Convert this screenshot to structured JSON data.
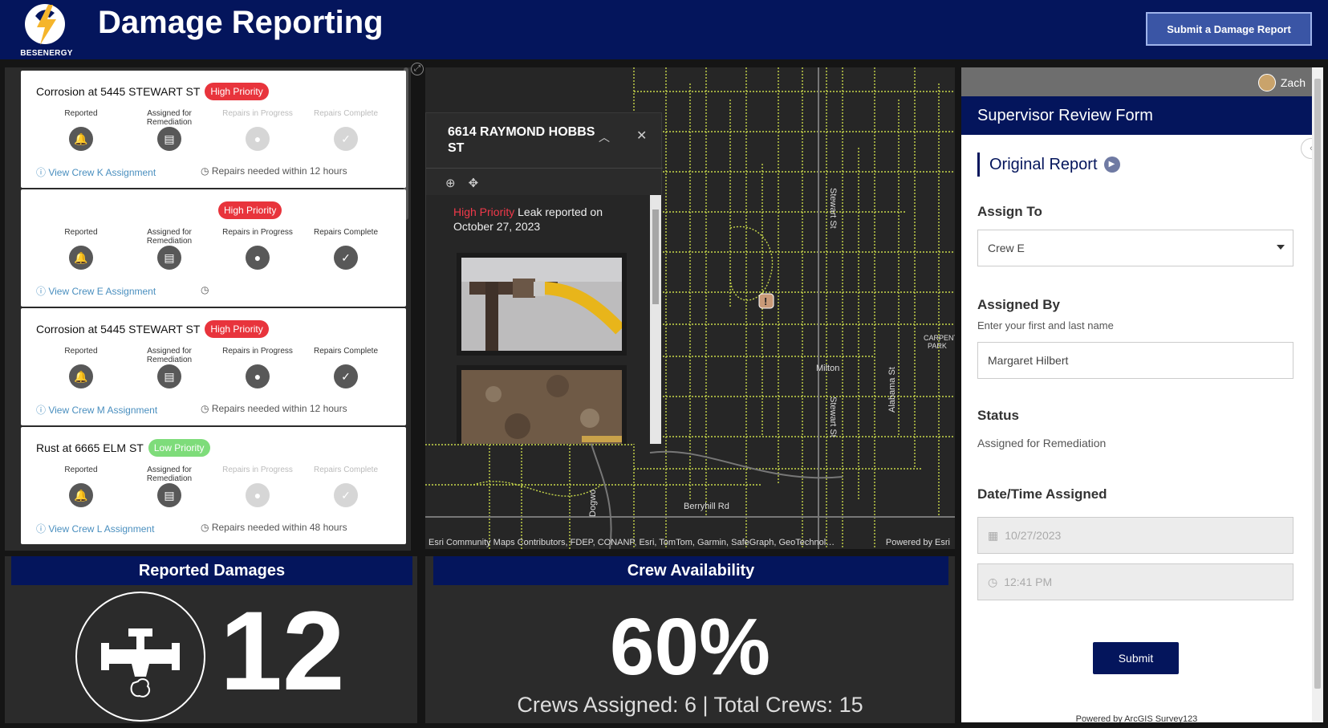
{
  "header": {
    "title": "Damage Reporting",
    "logo_text": "BESENERGY",
    "submit_button": "Submit a Damage Report"
  },
  "colors": {
    "navy": "#04155c",
    "high_priority": "#e8343c",
    "low_priority": "#7edc7a",
    "link": "#4a8fbf"
  },
  "step_labels": [
    "Reported",
    "Assigned for Remediation",
    "Repairs in Progress",
    "Repairs Complete"
  ],
  "cards": [
    {
      "title": "Corrosion at 5445 STEWART ST",
      "priority": "High Priority",
      "crew_link": "View Crew K Assignment",
      "repair_note": "Repairs needed within 12 hours"
    },
    {
      "title": "",
      "priority": "High Priority",
      "crew_link": "View Crew E Assignment",
      "repair_note": ""
    },
    {
      "title": "Corrosion at 5445 STEWART ST",
      "priority": "High Priority",
      "crew_link": "View Crew M Assignment",
      "repair_note": "Repairs needed within 12 hours"
    },
    {
      "title": "Rust at 6665 ELM ST",
      "priority": "Low Priority",
      "crew_link": "View Crew L Assignment",
      "repair_note": "Repairs needed within 48 hours"
    }
  ],
  "map": {
    "labels": {
      "stewart_n": "Stewart St",
      "stewart_s": "Stewart St",
      "alabama": "Alabama St",
      "milton": "Milton",
      "carpenter": "CARPENT",
      "carpenter2": "PARK",
      "berryhill": "Berryhill Rd",
      "dogwood": "Dogwo"
    },
    "attribution": "Esri Community Maps Contributors, FDEP, CONANP, Esri, TomTom, Garmin, SafeGraph, GeoTechnol…",
    "powered_by": "Powered by Esri"
  },
  "popup": {
    "title": "6614 RAYMOND HOBBS ST",
    "priority_word": "High Priority",
    "description": " Leak reported on October 27, 2023"
  },
  "reported_damages": {
    "title": "Reported Damages",
    "count": "12"
  },
  "crew_availability": {
    "title": "Crew Availability",
    "percent": "60%",
    "summary": "Crews Assigned: 6 | Total Crews: 15"
  },
  "form": {
    "user": "Zach",
    "title": "Supervisor Review Form",
    "section": "Original Report",
    "assign_to_label": "Assign To",
    "assign_to_value": "Crew E",
    "assigned_by_label": "Assigned By",
    "assigned_by_hint": "Enter your first and last name",
    "assigned_by_value": "Margaret Hilbert",
    "status_label": "Status",
    "status_value": "Assigned for Remediation",
    "datetime_label": "Date/Time Assigned",
    "date_value": "10/27/2023",
    "time_value": "12:41 PM",
    "submit": "Submit",
    "powered": "Powered by ArcGIS Survey123"
  }
}
